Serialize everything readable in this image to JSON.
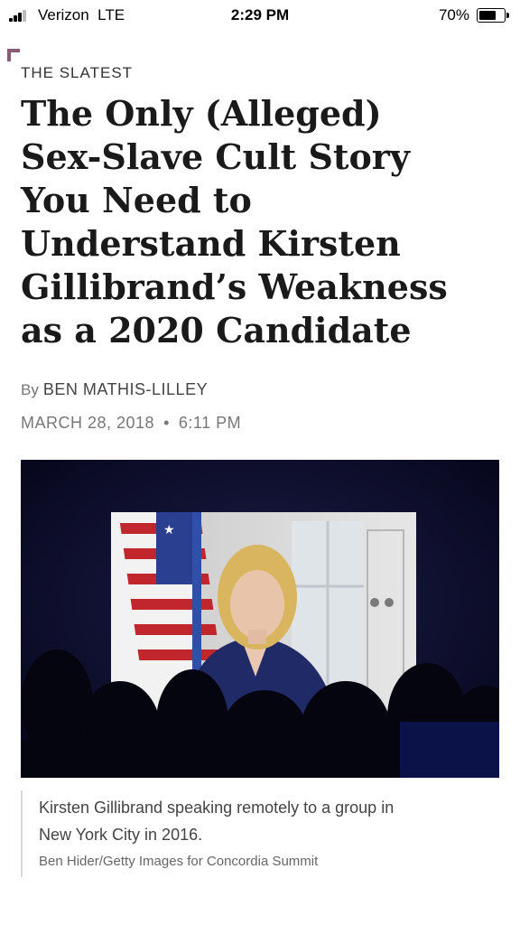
{
  "status_bar": {
    "carrier": "Verizon",
    "network": "LTE",
    "time": "2:29 PM",
    "battery_percent": "70%",
    "battery_level": 0.7
  },
  "article": {
    "section": "THE SLATEST",
    "headline_lines": [
      "The Only (Alleged)",
      "Sex-Slave Cult Story",
      "You Need to",
      "Understand Kirsten",
      "Gillibrand’s Weakness",
      "as a 2020 Candidate"
    ],
    "by_prefix": "By",
    "author": "BEN MATHIS-LILLEY",
    "date": "MARCH 28, 2018",
    "date_separator": "•",
    "time": "6:11 PM",
    "image_caption_lines": [
      "Kirsten Gillibrand speaking remotely to a group in",
      "New York City in 2016."
    ],
    "image_credit": "Ben Hider/Getty Images for Concordia Summit"
  },
  "colors": {
    "accent": "#8a5a76",
    "headline": "#1a1a1a",
    "meta": "#777777"
  }
}
